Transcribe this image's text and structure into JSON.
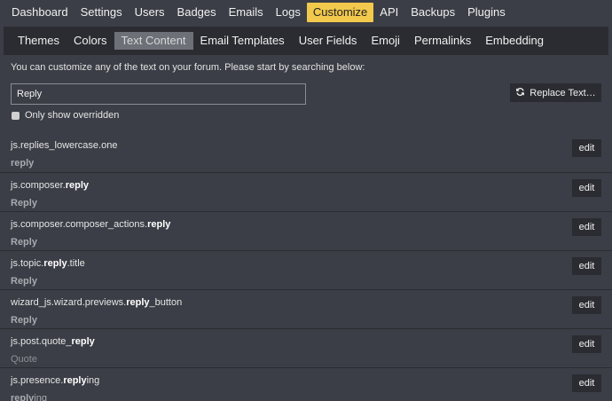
{
  "topnav": {
    "items": [
      "Dashboard",
      "Settings",
      "Users",
      "Badges",
      "Emails",
      "Logs",
      "Customize",
      "API",
      "Backups",
      "Plugins"
    ],
    "active": "Customize",
    "accent": "#f2c94c"
  },
  "subnav": {
    "items": [
      "Themes",
      "Colors",
      "Text Content",
      "Email Templates",
      "User Fields",
      "Emoji",
      "Permalinks",
      "Embedding"
    ],
    "active": "Text Content"
  },
  "intro": "You can customize any of the text on your forum. Please start by searching below:",
  "search": {
    "value": "Reply",
    "placeholder": ""
  },
  "replace_button": {
    "label": "Replace Text…",
    "icon": "sync-icon"
  },
  "override_checkbox": {
    "label": "Only show overridden",
    "checked": false
  },
  "edit_label": "edit",
  "rows": [
    {
      "key": [
        [
          "js.replies_lowercase.one",
          false
        ]
      ],
      "value": [
        [
          "reply",
          true
        ]
      ],
      "dim": false
    },
    {
      "key": [
        [
          "js.composer.",
          false
        ],
        [
          "reply",
          true
        ]
      ],
      "value": [
        [
          "Reply",
          true
        ]
      ],
      "dim": false
    },
    {
      "key": [
        [
          "js.composer.composer_actions.",
          false
        ],
        [
          "reply",
          true
        ]
      ],
      "value": [
        [
          "Reply",
          true
        ]
      ],
      "dim": false
    },
    {
      "key": [
        [
          "js.topic.",
          false
        ],
        [
          "reply",
          true
        ],
        [
          ".title",
          false
        ]
      ],
      "value": [
        [
          "Reply",
          true
        ]
      ],
      "dim": false
    },
    {
      "key": [
        [
          "wizard_js.wizard.previews.",
          false
        ],
        [
          "reply",
          true
        ],
        [
          "_button",
          false
        ]
      ],
      "value": [
        [
          "Reply",
          true
        ]
      ],
      "dim": false
    },
    {
      "key": [
        [
          "js.post.quote_",
          false
        ],
        [
          "reply",
          true
        ]
      ],
      "value": [
        [
          "Quote",
          false
        ]
      ],
      "dim": true
    },
    {
      "key": [
        [
          "js.presence.",
          false
        ],
        [
          "reply",
          true
        ],
        [
          "ing",
          false
        ]
      ],
      "value": [
        [
          "reply",
          true
        ],
        [
          "ing",
          false
        ]
      ],
      "dim": false
    }
  ]
}
